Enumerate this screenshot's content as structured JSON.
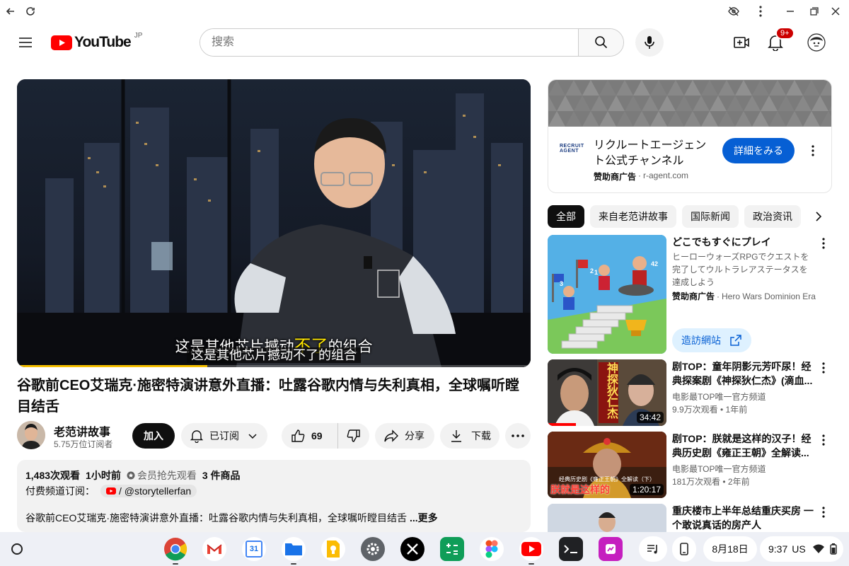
{
  "masthead": {
    "logo_text": "YouTube",
    "region": "JP",
    "search_placeholder": "搜索",
    "notif_badge": "9+"
  },
  "player": {
    "caption_burned": "这是其他芯片撼动不了的组合",
    "caption_highlight": "不了",
    "subtitle": "这是其他芯片撼动不了的组合",
    "progress": 0.37
  },
  "video": {
    "title": "谷歌前CEO艾瑞克·施密特演讲意外直播：吐露谷歌内情与失利真相，全球嘱听瞠目结舌",
    "channel": "老范讲故事",
    "subscribers": "5.75万位订阅者",
    "join_label": "加入",
    "subscribed_label": "已订阅",
    "likes": "69",
    "share_label": "分享",
    "download_label": "下载"
  },
  "description": {
    "views": "1,483次观看",
    "time": "1小时前",
    "members_first": "会员抢先观看",
    "products": "3 件商品",
    "paid_channel_label": "付费频道订阅：",
    "paid_channel_handle": "/ @storytellerfan",
    "text": "谷歌前CEO艾瑞克·施密特演讲意外直播：吐露谷歌内情与失利真相，全球嘱听瞠目结舌",
    "more": "...更多"
  },
  "ad": {
    "logo_line1": "RECRUIT",
    "logo_line2": "AGENT",
    "title": "リクルートエージェント公式チャンネル",
    "sponsor": "赞助商广告",
    "domain": "r-agent.com",
    "cta": "詳細をみる"
  },
  "chips": [
    "全部",
    "来自老范讲故事",
    "国际新闻",
    "政治资讯"
  ],
  "recommendations": [
    {
      "title": "どこでもすぐにプレイ",
      "desc": "ヒーローウォーズRPGでクエストを完了してウルトラレアステータスを達成しよう",
      "sponsor": "赞助商广告",
      "advertiser": "Hero Wars Dominion Era",
      "cta": "造訪網站",
      "thumb_labels": [
        "1",
        "2",
        "3",
        "42"
      ]
    },
    {
      "title": "剧TOP：童年阴影元芳吓尿！经典探案剧《神探狄仁杰》(滴血...",
      "channel": "电影最TOP唯一官方频道",
      "meta": "9.9万次观看 • 1年前",
      "duration": "34:42",
      "thumb_text": "神探狄仁杰"
    },
    {
      "title": "剧TOP：朕就是这样的汉子！经典历史剧《雍正王朝》全解读...",
      "channel": "电影最TOP唯一官方频道",
      "meta": "181万次观看 • 2年前",
      "duration": "1:20:17",
      "thumb_caption": "经典历史剧《雍正王朝》全解读（下）",
      "thumb_text": "朕就是这样的"
    },
    {
      "title": "重庆楼市上半年总结重庆买房 一个敢说真话的房产人"
    }
  ],
  "shelf": {
    "calendar_day": "31",
    "date": "8月18日",
    "time": "9:37",
    "locale": "US"
  },
  "colors": {
    "youtube_red": "#ff0000",
    "cta_blue": "#065fd4",
    "chip_active": "#0f0f0f",
    "subtitle_yellow": "#ffe600"
  }
}
